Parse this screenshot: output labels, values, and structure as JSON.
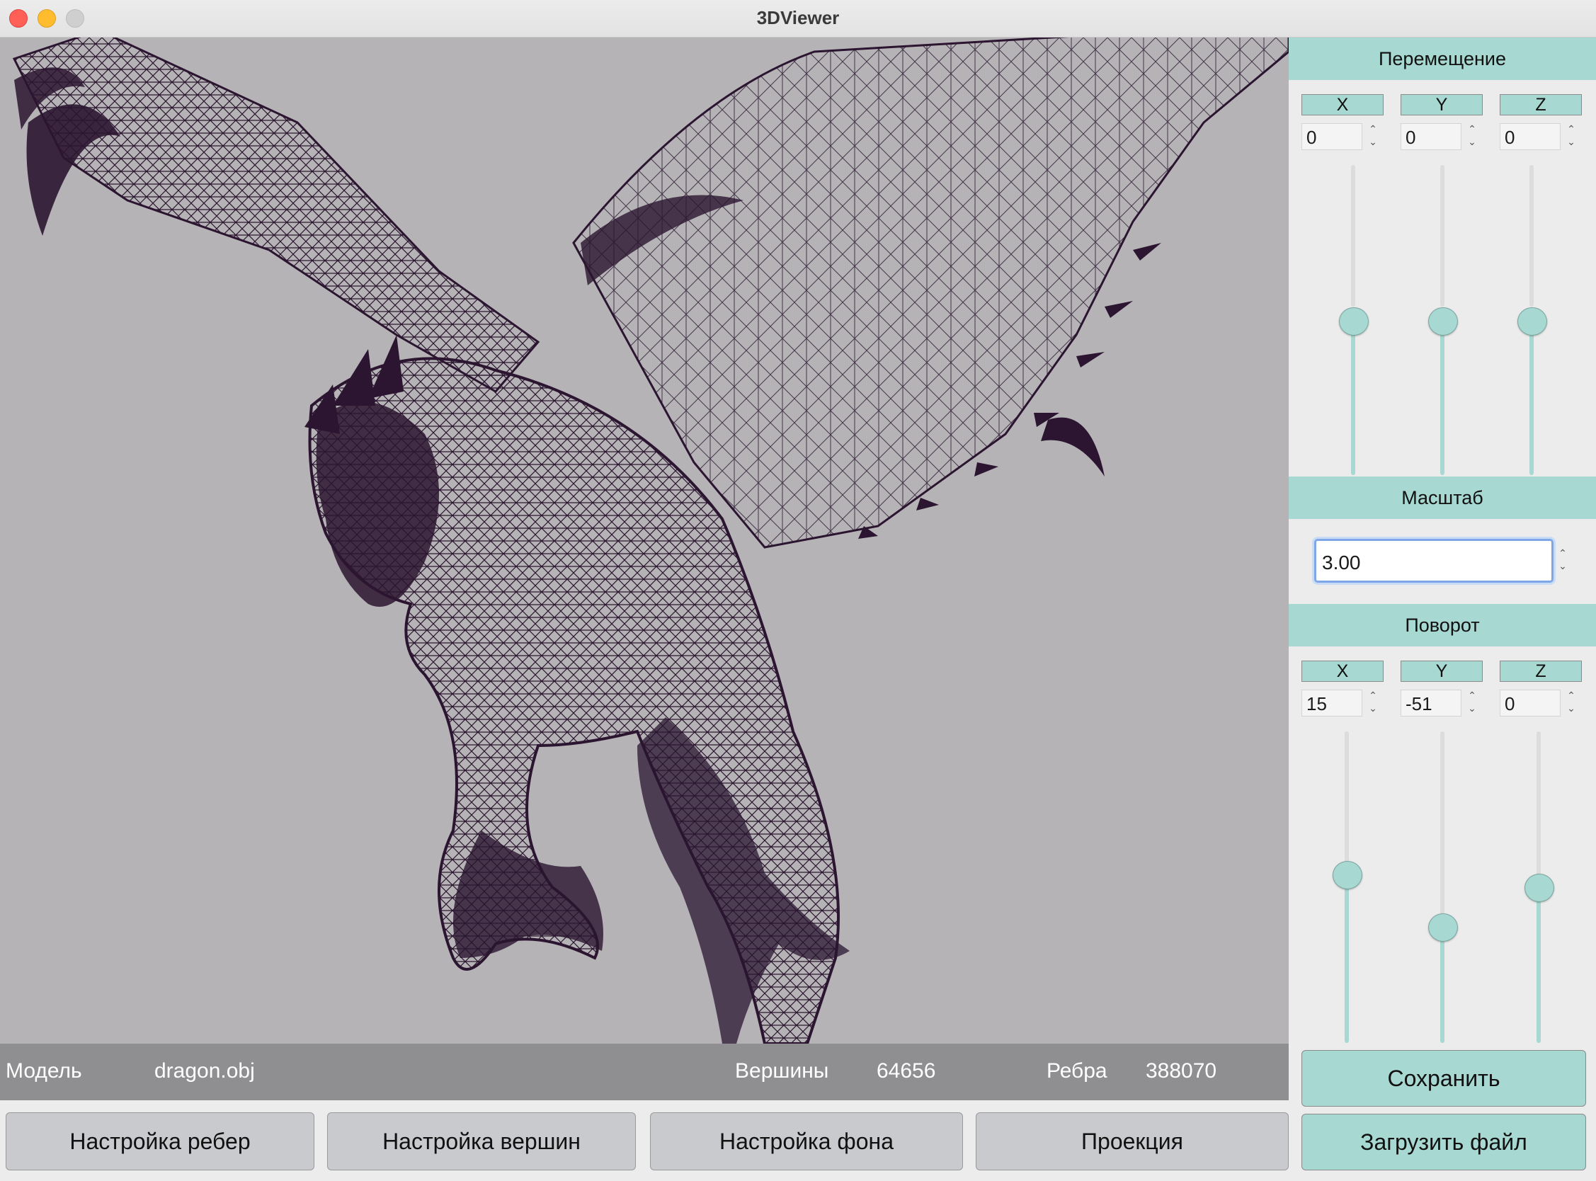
{
  "window": {
    "title": "3DViewer"
  },
  "info": {
    "model_label": "Модель",
    "model_value": "dragon.obj",
    "vertices_label": "Вершины",
    "vertices_value": "64656",
    "edges_label": "Ребра",
    "edges_value": "388070"
  },
  "bottom_buttons": [
    "Настройка ребер",
    "Настройка вершин",
    "Настройка фона",
    "Проекция"
  ],
  "translation": {
    "title": "Перемещение",
    "axes": [
      {
        "label": "X",
        "value": "0",
        "level": 0.5
      },
      {
        "label": "Y",
        "value": "0",
        "level": 0.5
      },
      {
        "label": "Z",
        "value": "0",
        "level": 0.5
      }
    ]
  },
  "scale": {
    "title": "Масштаб",
    "value": "3.00"
  },
  "rotation": {
    "title": "Поворот",
    "axes": [
      {
        "label": "X",
        "value": "15",
        "level": 0.54
      },
      {
        "label": "Y",
        "value": "-51",
        "level": 0.36
      },
      {
        "label": "Z",
        "value": "0",
        "level": 0.5
      }
    ]
  },
  "actions": {
    "save": "Сохранить",
    "load": "Загрузить файл"
  },
  "colors": {
    "viewport_bg": "#b5b3b6",
    "wireframe": "#2b1530",
    "accent": "#a7d8d1",
    "infobar": "#8f8f91"
  },
  "icons": [
    "close-window-icon",
    "minimize-window-icon",
    "maximize-window-icon",
    "spin-up-icon",
    "spin-down-icon"
  ]
}
